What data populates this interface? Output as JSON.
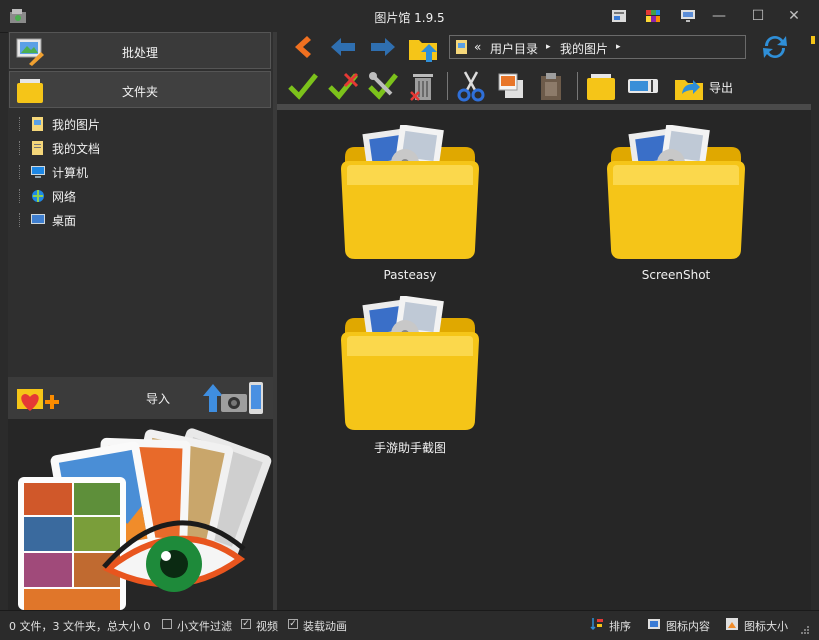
{
  "window": {
    "title": "图片馆 1.9.5",
    "minimize": "—",
    "maximize": "☐",
    "close": "✕"
  },
  "sidebar": {
    "batch_label": "批处理",
    "folder_label": "文件夹",
    "tree": [
      {
        "label": "我的图片",
        "icon": "pictures-folder-icon"
      },
      {
        "label": "我的文档",
        "icon": "documents-folder-icon"
      },
      {
        "label": "计算机",
        "icon": "computer-icon"
      },
      {
        "label": "网络",
        "icon": "network-icon"
      },
      {
        "label": "桌面",
        "icon": "desktop-icon"
      }
    ],
    "import_label": "导入"
  },
  "address": {
    "prefix": "«",
    "segments": [
      "用户目录",
      "我的图片"
    ],
    "separator": "▸"
  },
  "toolbar": {
    "export_label": "导出"
  },
  "folders": [
    {
      "label": "Pasteasy"
    },
    {
      "label": "ScreenShot"
    },
    {
      "label": "手游助手截图"
    }
  ],
  "status": {
    "summary": "0 文件，3 文件夹，总大小 0",
    "small_file_filter": "小文件过滤",
    "small_file_filter_checked": false,
    "video": "视频",
    "video_checked": true,
    "loading_animation": "装载动画",
    "loading_animation_checked": true,
    "sort": "排序",
    "icon_content": "图标内容",
    "icon_size": "图标大小",
    "check_mark": "✓"
  },
  "colors": {
    "background": "#2b2b2b",
    "folder_yellow": "#f5c518",
    "accent_blue": "#2f8fd8",
    "accent_green": "#7cc21b"
  }
}
